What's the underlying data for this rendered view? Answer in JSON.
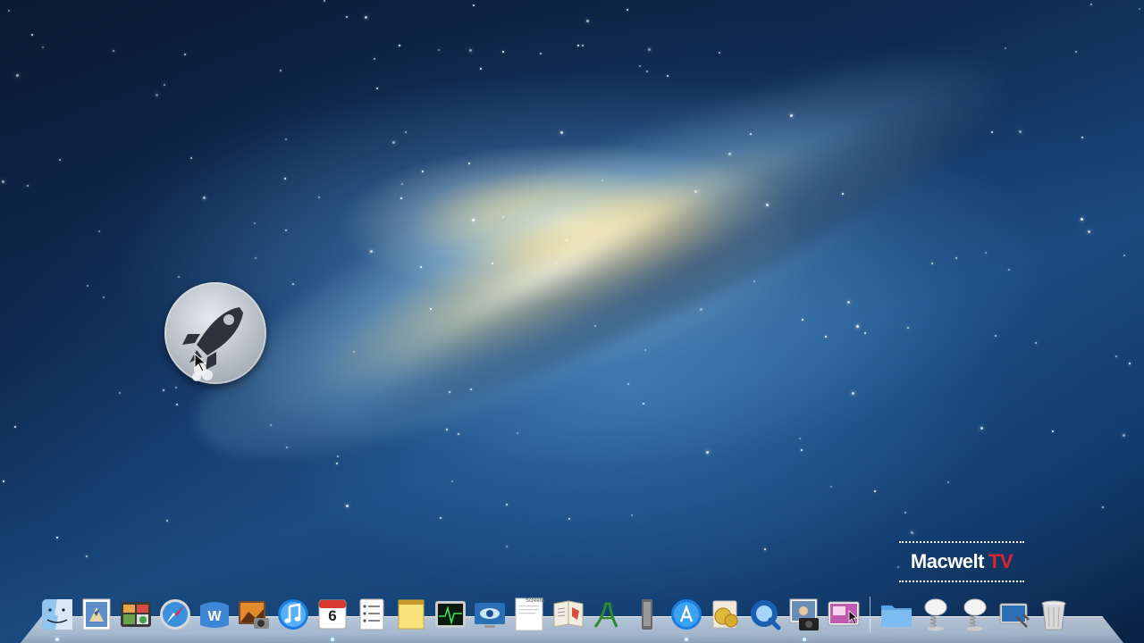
{
  "wallpaper": "mountain-lion-galaxy",
  "launchpad_float_icon": "launchpad-rocket-icon",
  "watermark": {
    "brand": "Macwelt",
    "suffix": "TV",
    "brand_color": "#ffffff",
    "suffix_color": "#e3222b"
  },
  "dock": {
    "apps": [
      {
        "name": "Finder",
        "icon": "finder-icon"
      },
      {
        "name": "Mail",
        "icon": "mail-stamp-icon"
      },
      {
        "name": "Dashboard",
        "icon": "dashboard-icon"
      },
      {
        "name": "Safari",
        "icon": "safari-compass-icon"
      },
      {
        "name": "Microsoft Word",
        "icon": "word-icon"
      },
      {
        "name": "Photo Booth",
        "icon": "photo-booth-icon"
      },
      {
        "name": "iTunes",
        "icon": "itunes-note-icon"
      },
      {
        "name": "Calendar",
        "icon": "calendar-icon",
        "day": "6"
      },
      {
        "name": "Reminders",
        "icon": "reminders-icon"
      },
      {
        "name": "Notes",
        "icon": "notes-icon"
      },
      {
        "name": "Activity Monitor",
        "icon": "activity-monitor-icon"
      },
      {
        "name": "Screen Sharing",
        "icon": "screen-sharing-eye-icon"
      },
      {
        "name": "Preview",
        "icon": "preview-document-icon",
        "label": "Screens"
      },
      {
        "name": "Contacts",
        "icon": "contacts-book-icon"
      },
      {
        "name": "Font Book",
        "icon": "font-book-icon"
      },
      {
        "name": "Utility",
        "icon": "tall-device-icon"
      },
      {
        "name": "App Store",
        "icon": "app-store-icon"
      },
      {
        "name": "Coin App",
        "icon": "coins-icon"
      },
      {
        "name": "QuickTime Player",
        "icon": "quicktime-icon"
      },
      {
        "name": "Image Capture",
        "icon": "image-capture-icon"
      },
      {
        "name": "iPhoto",
        "icon": "iphoto-icon"
      }
    ],
    "stacks": [
      {
        "name": "Applications",
        "icon": "folder-icon"
      },
      {
        "name": "Downloads",
        "icon": "spring-stack-icon"
      },
      {
        "name": "Documents",
        "icon": "spring-stack-icon"
      },
      {
        "name": "Desktop",
        "icon": "desktop-screen-icon"
      },
      {
        "name": "Trash",
        "icon": "trash-icon"
      }
    ]
  }
}
